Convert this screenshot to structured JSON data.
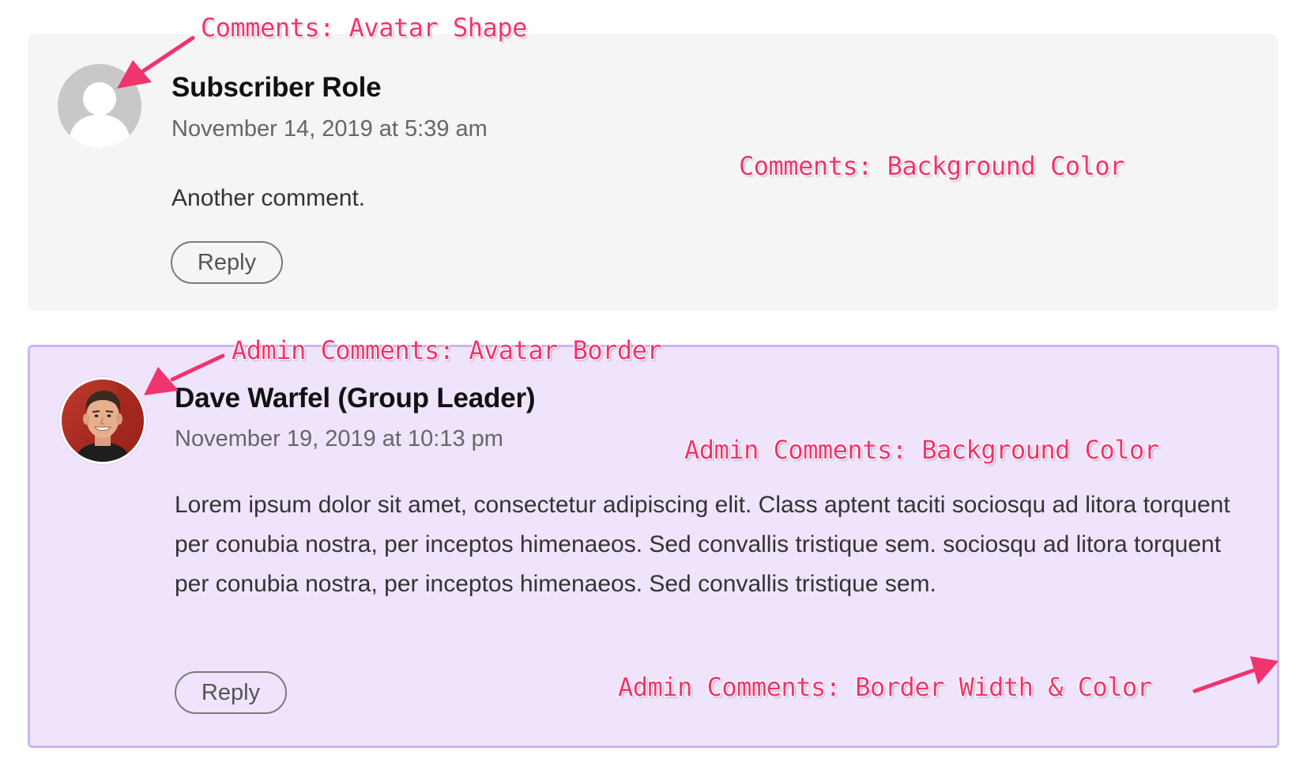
{
  "comments": [
    {
      "author": "Subscriber Role",
      "date": "November 14, 2019 at 5:39 am",
      "body": "Another comment.",
      "reply_label": "Reply",
      "background_color": "#f5f5f5"
    },
    {
      "author": "Dave Warfel (Group Leader)",
      "date": "November 19, 2019 at 10:13 pm",
      "body": "Lorem ipsum dolor sit amet, consectetur adipiscing elit. Class aptent taciti sociosqu ad litora torquent per conubia nostra, per inceptos himenaeos. Sed convallis tristique sem. sociosqu ad litora torquent per conubia nostra, per inceptos himenaeos. Sed convallis tristique sem.",
      "reply_label": "Reply",
      "background_color": "#efe4fc",
      "border_color": "#cbb6f0"
    }
  ],
  "annotations": {
    "avatar_shape": "Comments: Avatar Shape",
    "background_color": "Comments: Background Color",
    "admin_avatar_border": "Admin Comments: Avatar Border",
    "admin_background_color": "Admin Comments: Background Color",
    "admin_border": "Admin Comments: Border Width & Color",
    "color": "#f0346e"
  }
}
